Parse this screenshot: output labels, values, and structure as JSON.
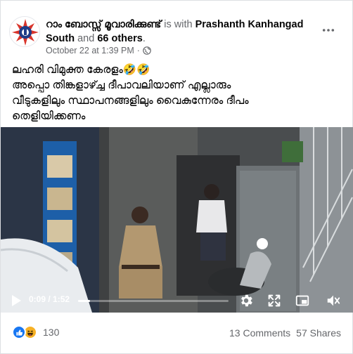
{
  "post": {
    "author_name": "റാം ബോസ്സ് മൂവാരിക്കുണ്ട്",
    "with_text": "is with",
    "tagged_person": "Prashanth Kanhangad South",
    "and_text": "and",
    "others": "66 others",
    "period": ".",
    "date": "October 22 at 1:39 PM",
    "dot": "·",
    "text_lines": [
      "ലഹരി വിമുക്ത കേരളം🤣🤣",
      "അപ്പൊ തിങ്കളാഴ്ച്ച ദീപാവലിയാണ് എല്ലാരും",
      "വീടുകളിലും സ്ഥാപനങ്ങളിലും വൈകുന്നേരം ദീപം",
      "തെളിയിക്കണം"
    ]
  },
  "video": {
    "time_display": "0:09 / 1:52",
    "progress": 0.08
  },
  "footer": {
    "reaction_count": "130",
    "comments": "13 Comments",
    "shares": "57 Shares"
  },
  "icons": {
    "more": "more-options-icon",
    "globe": "globe-icon",
    "play": "play-icon",
    "settings": "settings-icon",
    "fullscreen": "fullscreen-icon",
    "pip": "picture-in-picture-icon",
    "volume": "volume-icon",
    "like": "like-reaction-icon",
    "haha": "haha-reaction-icon"
  },
  "colors": {
    "accent": "#1877f2",
    "haha": "#f7b125",
    "secondary_text": "#65676b"
  }
}
